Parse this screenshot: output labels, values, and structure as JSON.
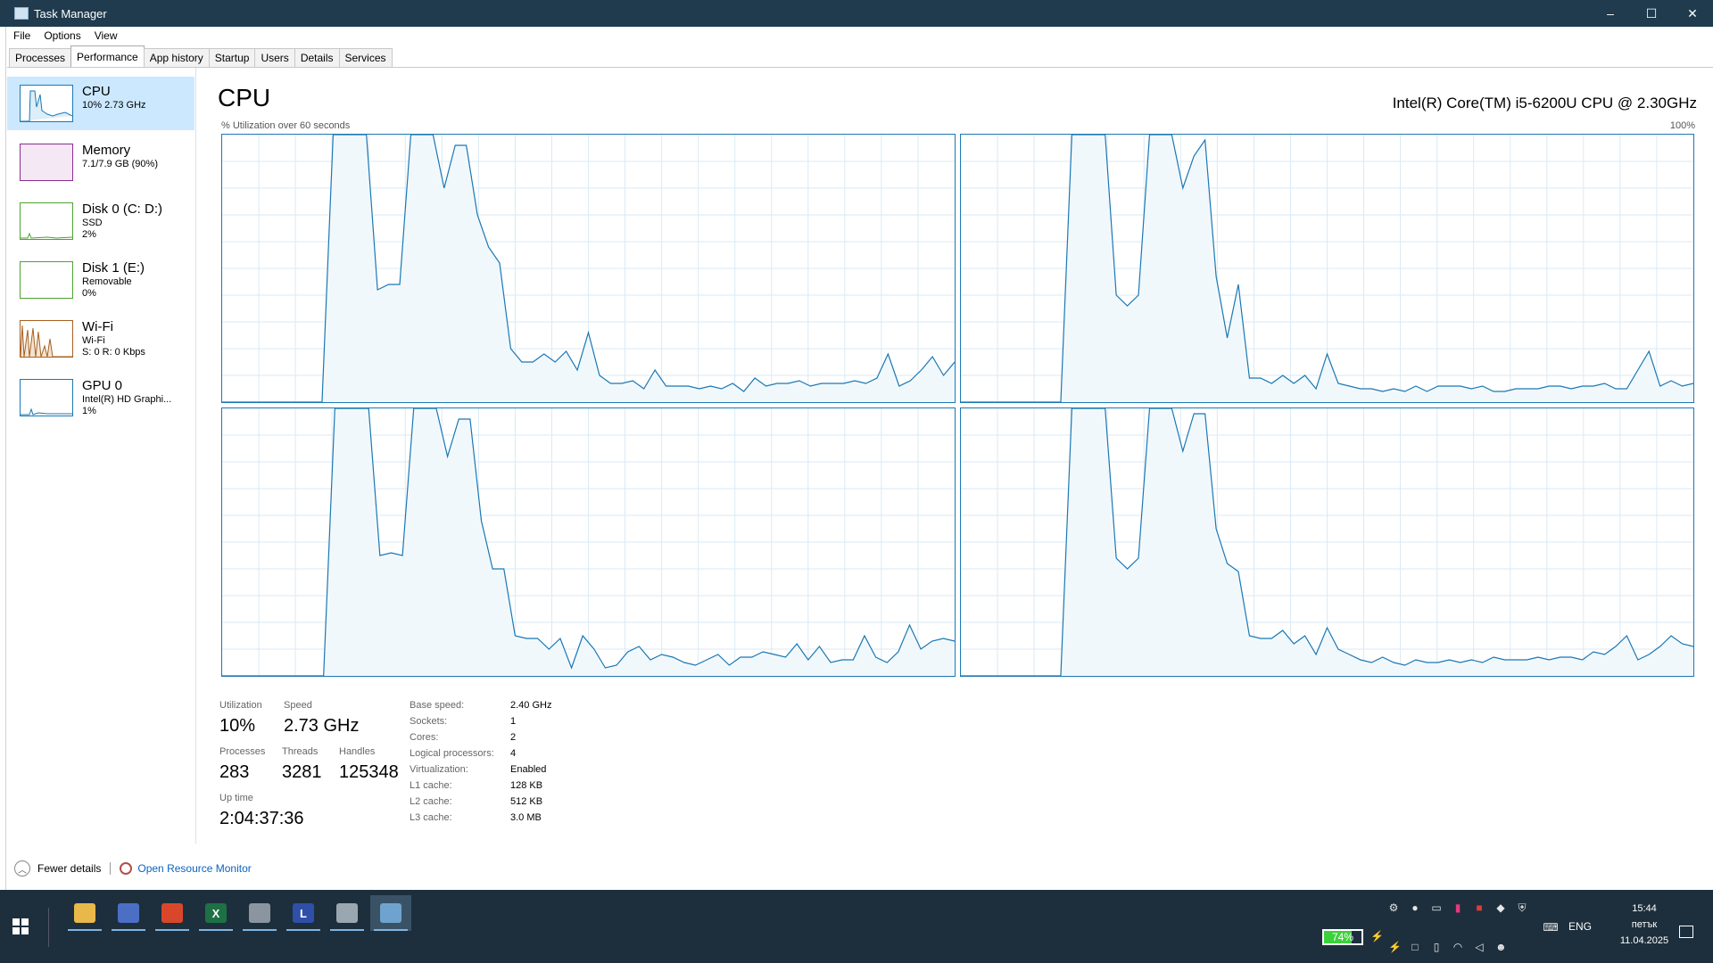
{
  "window": {
    "title": "Task Manager",
    "minimize": "–",
    "maximize": "☐",
    "close": "✕"
  },
  "menu": [
    "File",
    "Options",
    "View"
  ],
  "tabs": [
    "Processes",
    "Performance",
    "App history",
    "Startup",
    "Users",
    "Details",
    "Services"
  ],
  "active_tab": "Performance",
  "sidebar": [
    {
      "title": "CPU",
      "line1": "10%  2.73 GHz",
      "line2": "",
      "color": "#1a78b4",
      "active": true
    },
    {
      "title": "Memory",
      "line1": "7.1/7.9 GB (90%)",
      "line2": "",
      "color": "#8b2f8f",
      "active": false
    },
    {
      "title": "Disk 0 (C: D:)",
      "line1": "SSD",
      "line2": "2%",
      "color": "#4da232",
      "active": false
    },
    {
      "title": "Disk 1 (E:)",
      "line1": "Removable",
      "line2": "0%",
      "color": "#4da232",
      "active": false
    },
    {
      "title": "Wi-Fi",
      "line1": "Wi-Fi",
      "line2": "S: 0  R: 0 Kbps",
      "color": "#a7601f",
      "active": false
    },
    {
      "title": "GPU 0",
      "line1": "Intel(R) HD Graphi...",
      "line2": "1%",
      "color": "#1a78b4",
      "active": false
    }
  ],
  "main": {
    "title": "CPU",
    "cpu_name": "Intel(R) Core(TM) i5-6200U CPU @ 2.30GHz",
    "graph_caption": "% Utilization over 60 seconds",
    "graph_max": "100%"
  },
  "chart_data": {
    "type": "area",
    "title": "% Utilization over 60 seconds",
    "ylim": [
      0,
      100
    ],
    "xlabel": "",
    "ylabel": "% Utilization",
    "grid": true,
    "series": [
      {
        "values": [
          0,
          0,
          0,
          0,
          0,
          0,
          0,
          0,
          0,
          0,
          100,
          100,
          100,
          100,
          42,
          44,
          44,
          100,
          100,
          100,
          80,
          96,
          96,
          70,
          58,
          52,
          20,
          15,
          15,
          18,
          15,
          19,
          12,
          26,
          10,
          7,
          7,
          8,
          5,
          12,
          6,
          6,
          6,
          5,
          6,
          5,
          7,
          4,
          9,
          6,
          7,
          7,
          8,
          6,
          7,
          7,
          7,
          8,
          7,
          9,
          18,
          6,
          8,
          12,
          17,
          10,
          15
        ]
      },
      {
        "values": [
          0,
          0,
          0,
          0,
          0,
          0,
          0,
          0,
          0,
          0,
          100,
          100,
          100,
          100,
          40,
          36,
          40,
          100,
          100,
          100,
          80,
          92,
          98,
          47,
          24,
          44,
          9,
          9,
          7,
          10,
          7,
          10,
          5,
          18,
          7,
          6,
          5,
          5,
          4,
          5,
          4,
          6,
          4,
          6,
          6,
          6,
          5,
          6,
          4,
          4,
          5,
          5,
          5,
          6,
          6,
          5,
          6,
          6,
          7,
          5,
          5,
          12,
          19,
          6,
          8,
          6,
          7
        ]
      },
      {
        "values": [
          0,
          0,
          0,
          0,
          0,
          0,
          0,
          0,
          0,
          0,
          100,
          100,
          100,
          100,
          45,
          46,
          45,
          100,
          100,
          100,
          82,
          96,
          96,
          58,
          40,
          40,
          15,
          14,
          14,
          10,
          14,
          3,
          15,
          10,
          3,
          4,
          9,
          11,
          6,
          8,
          7,
          5,
          4,
          6,
          8,
          4,
          7,
          7,
          9,
          8,
          7,
          12,
          6,
          11,
          5,
          6,
          6,
          15,
          7,
          5,
          9,
          19,
          10,
          13,
          14,
          13
        ]
      },
      {
        "values": [
          0,
          0,
          0,
          0,
          0,
          0,
          0,
          0,
          0,
          0,
          100,
          100,
          100,
          100,
          44,
          40,
          44,
          100,
          100,
          100,
          84,
          98,
          98,
          55,
          42,
          39,
          15,
          14,
          14,
          17,
          12,
          15,
          8,
          18,
          10,
          8,
          6,
          5,
          7,
          5,
          4,
          6,
          5,
          5,
          6,
          5,
          6,
          5,
          7,
          6,
          6,
          6,
          7,
          6,
          7,
          7,
          6,
          9,
          8,
          11,
          15,
          6,
          8,
          11,
          15,
          12,
          11
        ]
      }
    ]
  },
  "stats": {
    "utilization_label": "Utilization",
    "utilization": "10%",
    "speed_label": "Speed",
    "speed": "2.73 GHz",
    "processes_label": "Processes",
    "processes": "283",
    "threads_label": "Threads",
    "threads": "3281",
    "handles_label": "Handles",
    "handles": "125348",
    "uptime_label": "Up time",
    "uptime": "2:04:37:36"
  },
  "details": [
    {
      "label": "Base speed:",
      "value": "2.40 GHz"
    },
    {
      "label": "Sockets:",
      "value": "1"
    },
    {
      "label": "Cores:",
      "value": "2"
    },
    {
      "label": "Logical processors:",
      "value": "4"
    },
    {
      "label": "Virtualization:",
      "value": "Enabled"
    },
    {
      "label": "L1 cache:",
      "value": "128 KB"
    },
    {
      "label": "L2 cache:",
      "value": "512 KB"
    },
    {
      "label": "L3 cache:",
      "value": "3.0 MB"
    }
  ],
  "footer": {
    "fewer_details": "Fewer details",
    "open_resource_monitor": "Open Resource Monitor"
  },
  "taskbar": {
    "apps": [
      {
        "name": "file-explorer",
        "glyph": "",
        "color": "#e8b84a"
      },
      {
        "name": "save-app",
        "glyph": "",
        "color": "#4b6fc4"
      },
      {
        "name": "chrome",
        "glyph": "",
        "color": "#d9472b"
      },
      {
        "name": "excel",
        "glyph": "X",
        "color": "#1e7145"
      },
      {
        "name": "remote-app",
        "glyph": "",
        "color": "#8a95a0"
      },
      {
        "name": "l-app",
        "glyph": "L",
        "color": "#2f4fa8"
      },
      {
        "name": "paint-app",
        "glyph": "",
        "color": "#9aa7b0"
      },
      {
        "name": "task-manager",
        "glyph": "",
        "color": "#6fa3cf"
      }
    ],
    "battery": "74%",
    "battery_level": 0.74,
    "language": "ENG",
    "time": "15:44",
    "day": "петък",
    "date": "11.04.2025"
  }
}
